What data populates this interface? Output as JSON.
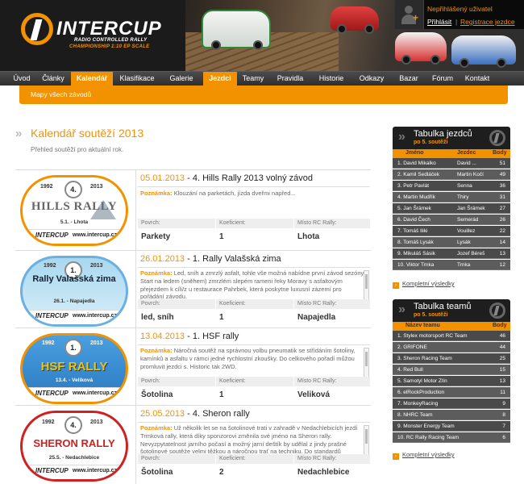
{
  "header": {
    "logo_title": "INTERCUP",
    "logo_line1": "RADIO CONTROLLED RALLY",
    "logo_line2": "CHAMPIONSHIP 1:10 EP SCALE",
    "user_status": "Nepřihlášený uživatel",
    "login": "Přihlásit",
    "separator": "|",
    "register": "Registrace jezdce"
  },
  "nav": {
    "items": [
      "Úvod",
      "Články",
      "Kalendář",
      "Klasifikace",
      "Galerie",
      "Jezdci",
      "Teamy",
      "Pravidla",
      "Historie",
      "Odkazy",
      "Bazar",
      "Fórum",
      "Kontakt"
    ],
    "active": [
      "Kalendář",
      "Jezdci"
    ],
    "sub_item": "Mapy všech závodů"
  },
  "page": {
    "title": "Kalendář soutěží 2013",
    "subtitle": "Přehled soutěží pro aktuální rok."
  },
  "labels": {
    "note": "Poznámka:",
    "surface": "Povrch:",
    "coef": "Koeficient:",
    "venue": "Místo RC Rally:"
  },
  "races": [
    {
      "date": "05.01.2013",
      "dash": " - ",
      "name": "4. Hills Rally 2013 volný závod",
      "note": "Klouzání na parketách, jízda dveřmi napřed...",
      "surface": "Parkety",
      "coef": "1",
      "venue": "Lhota",
      "plate": {
        "year": "1992",
        "num": "4.",
        "year2": "2013",
        "title": "HILLS RALLY",
        "date": "5.1. - Lhota",
        "logo": "INTERCUP",
        "url": "www.intercup.cz"
      }
    },
    {
      "date": "26.01.2013",
      "dash": " - ",
      "name": "1. Rally Valašská zima",
      "note": "Led, sníh a zmrzlý asfalt, tohle vše možná nabídne první závod sezóny. Start na ledem (sněhem) zmrzlém slepém rameni řeky Moravy s asfaltovým přejezdem k cíli/z u restaurace Pahrbek, která poskytne luxusní zázemí pro pořádání závodu.",
      "surface": "led, sníh",
      "coef": "1",
      "venue": "Napajedla",
      "plate": {
        "year": "1992",
        "num": "1.",
        "year2": "2013",
        "title": "Rally Valašská zima",
        "date": "26.1. - Napajedla",
        "logo": "INTERCUP",
        "url": "www.intercup.cz"
      }
    },
    {
      "date": "13.04.2013",
      "dash": " - ",
      "name": "1. HSF rally",
      "note": "Náročná soutěž na správnou volbu pneumatik se střídáním šotoliny, kamínků a asfaltu v rámci jedné rychlostní zkoušky. Do celkového pořadí můžou promluvit jezdci s. Historic tak 2WD.",
      "surface": "Šotolina",
      "coef": "1",
      "venue": "Veliková",
      "plate": {
        "year": "1992",
        "num": "1.",
        "year2": "2013",
        "title": "HSF RALLY",
        "date": "13.4. - Veliková",
        "logo": "INTERCUP",
        "url": "www.intercup.cz"
      }
    },
    {
      "date": "25.05.2013",
      "dash": " - ",
      "name": "4. Sheron rally",
      "note": "Už několik let se na šotolinové trati v zahradě v Nedachlebicích jezdí Trmková rally, která díky sponzorovi změnila své jméno na Sheron rally. Nevyzpytatelnost jarního počasí a možný jarní deštík by udělal z jindy prašné šotolinové soutěže velmi těžkou a náročnou trať na techniku. Do standardů",
      "surface": "Šotolina",
      "coef": "2",
      "venue": "Nedachlebice",
      "plate": {
        "year": "1992",
        "num": "4.",
        "year2": "2013",
        "title": "SHERON RALLY",
        "date": "25.5. - Nedachlebice",
        "logo": "INTERCUP",
        "url": "www.intercup.cz"
      }
    }
  ],
  "drivers_table": {
    "title": "Tabulka jezdců",
    "subtitle": "po 5. soutěži",
    "cols": [
      "Jméno",
      "Jezdec",
      "Body"
    ],
    "rows": [
      [
        "1. David Mikalko",
        "David ...",
        "51"
      ],
      [
        "2. Kamil Sedláček",
        "Martin Kočí",
        "49"
      ],
      [
        "3. Petr Pavlát",
        "Senna",
        "36"
      ],
      [
        "4. Martin Mudřík",
        "Thiry",
        "31"
      ],
      [
        "5. Jan Šrámek",
        "Jan Šrámek",
        "27"
      ],
      [
        "6. David Čech",
        "Semerád",
        "26"
      ],
      [
        "7. Tomáš Iliki",
        "Vouillez",
        "22"
      ],
      [
        "8. Tomáš Lysák",
        "Lysák",
        "14"
      ],
      [
        "9. Mikuláš Sásik",
        "Jozef Béreš",
        "13"
      ],
      [
        "10. Viktor Trnka",
        "Trnka",
        "12"
      ]
    ],
    "link": "Kompletní výsledky"
  },
  "teams_table": {
    "title": "Tabulka teamů",
    "subtitle": "po 5. soutěži",
    "cols": [
      "Název teamu",
      "Body"
    ],
    "rows": [
      [
        "1. Stylex motorsport RC Team",
        "46"
      ],
      [
        "2. GRIFONE",
        "44"
      ],
      [
        "3. Sheron Racing Team",
        "25"
      ],
      [
        "4. Red Bull",
        "15"
      ],
      [
        "5. Samotyl Motor Zlín",
        "13"
      ],
      [
        "6. elRockProduction",
        "11"
      ],
      [
        "7. MonkeyRacing",
        "9"
      ],
      [
        "8. NHRC Team",
        "8"
      ],
      [
        "9. Monster Energy Team",
        "7"
      ],
      [
        "10. RC Rally Racing Team",
        "6"
      ]
    ],
    "link": "Kompletní výsledky"
  },
  "colors": {
    "accent": "#f39200",
    "dark": "#1e1e1e",
    "row": "#4a4a4a"
  }
}
